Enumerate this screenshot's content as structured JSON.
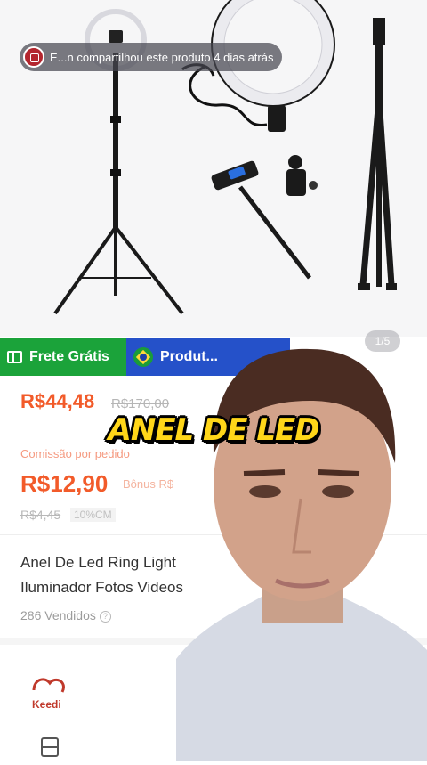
{
  "share_toast": {
    "text": "E...n compartilhou este produto 4 dias atrás"
  },
  "gallery": {
    "indicator": "1/5"
  },
  "badges": {
    "free_shipping": "Frete Grátis",
    "national": "Produt..."
  },
  "price": {
    "current": "R$44,48",
    "original": "R$170,00"
  },
  "commission": {
    "label": "Comissão por pedido",
    "value": "R$12,90",
    "bonus": "Bônus R$",
    "old_value": "R$4,45",
    "rate": "10%CM"
  },
  "product": {
    "title_line1": "Anel De Led Ring Light",
    "title_line2": "Iluminador Fotos Videos",
    "sold": "286 Vendidos"
  },
  "seller": {
    "logo_text": "Keedi"
  },
  "caption": {
    "text": "ANEL DE LED"
  },
  "colors": {
    "accent": "#f25b2a",
    "free_shipping_bg": "#1ba33a",
    "national_bg": "#2551c9",
    "caption_fill": "#ffd619"
  }
}
